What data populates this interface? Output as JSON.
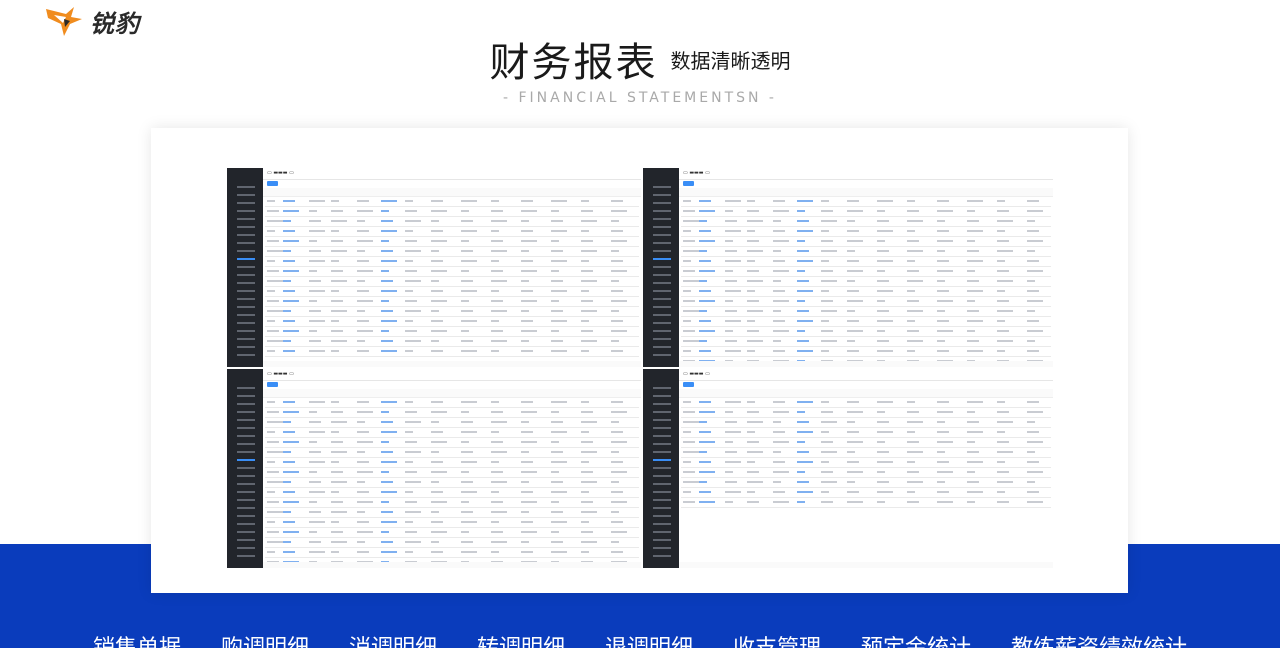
{
  "brand": {
    "logo_text": "锐豹",
    "accent": "#f08c1e"
  },
  "header": {
    "title": "财务报表",
    "subtitle": "数据清晰透明",
    "english": "- FINANCIAL STATEMENTSN -"
  },
  "nav": {
    "items": [
      "销售单据",
      "购调明细",
      "消调明细",
      "转调明细",
      "退调明细",
      "收支管理",
      "预定金统计",
      "教练薪资绩效统计"
    ]
  },
  "colors": {
    "band": "#0a3cbc",
    "sidebar": "#22252b",
    "link": "#3a8ef6"
  }
}
